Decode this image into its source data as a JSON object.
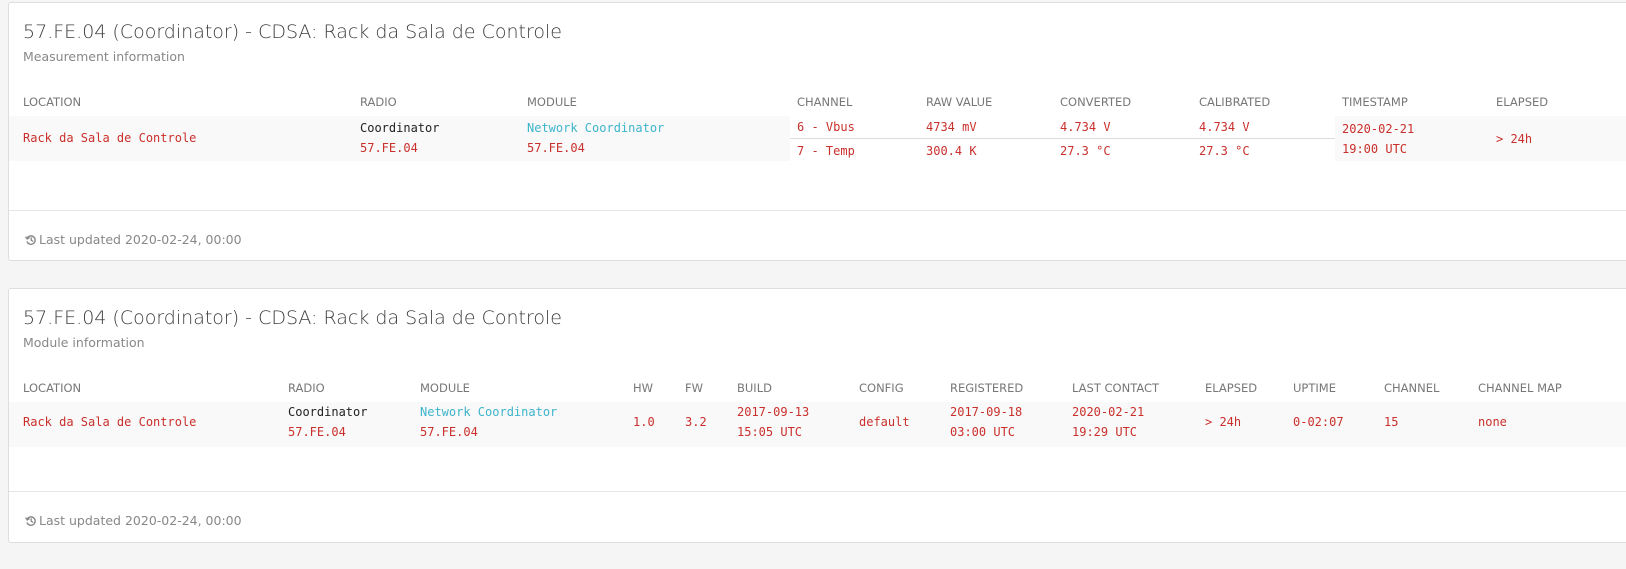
{
  "measurement_panel": {
    "title": "57.FE.04 (Coordinator) - CDSA: Rack da Sala de Controle",
    "subtitle": "Measurement information",
    "headers": {
      "location": "LOCATION",
      "radio": "RADIO",
      "module": "MODULE",
      "channel": "CHANNEL",
      "raw_value": "RAW VALUE",
      "converted": "CONVERTED",
      "calibrated": "CALIBRATED",
      "timestamp": "TIMESTAMP",
      "elapsed": "ELAPSED"
    },
    "row": {
      "location": "Rack da Sala de Controle",
      "radio_name": "Coordinator",
      "radio_id": "57.FE.04",
      "module_name": "Network Coordinator",
      "module_id": "57.FE.04",
      "channels": [
        {
          "channel": "6 - Vbus",
          "raw": "4734 mV",
          "converted": "4.734 V",
          "calibrated": "4.734 V"
        },
        {
          "channel": "7 - Temp",
          "raw": "300.4 K",
          "converted": "27.3 °C",
          "calibrated": "27.3 °C"
        }
      ],
      "timestamp_date": "2020-02-21",
      "timestamp_time": "19:00 UTC",
      "elapsed": "> 24h"
    },
    "footer": "Last updated 2020-02-24, 00:00"
  },
  "module_panel": {
    "title": "57.FE.04 (Coordinator) - CDSA: Rack da Sala de Controle",
    "subtitle": "Module information",
    "headers": {
      "location": "LOCATION",
      "radio": "RADIO",
      "module": "MODULE",
      "hw": "HW",
      "fw": "FW",
      "build": "BUILD",
      "config": "CONFIG",
      "registered": "REGISTERED",
      "last_contact": "LAST CONTACT",
      "elapsed": "ELAPSED",
      "uptime": "UPTIME",
      "channel": "CHANNEL",
      "channel_map": "CHANNEL MAP"
    },
    "row": {
      "location": "Rack da Sala de Controle",
      "radio_name": "Coordinator",
      "radio_id": "57.FE.04",
      "module_name": "Network Coordinator",
      "module_id": "57.FE.04",
      "hw": "1.0",
      "fw": "3.2",
      "build_date": "2017-09-13",
      "build_time": "15:05 UTC",
      "config": "default",
      "registered_date": "2017-09-18",
      "registered_time": "03:00 UTC",
      "last_contact_date": "2020-02-21",
      "last_contact_time": "19:29 UTC",
      "elapsed": "> 24h",
      "uptime": "0-02:07",
      "channel": "15",
      "channel_map": "none"
    },
    "footer": "Last updated 2020-02-24, 00:00"
  },
  "icons": {
    "footer_icon": "history-icon"
  },
  "colors": {
    "value_red": "#c9302c",
    "link_cyan": "#3db4cb",
    "page_bg": "#f5f5f6",
    "row_bg": "#f9f9f9"
  }
}
